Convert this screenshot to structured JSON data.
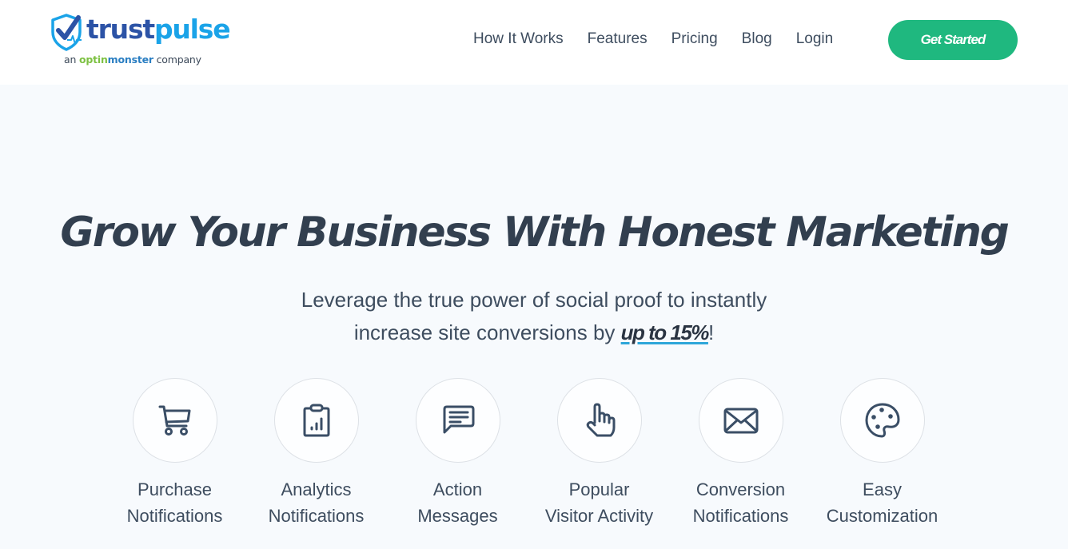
{
  "header": {
    "logo": {
      "word_part1": "trust",
      "word_part2": "pulse",
      "sub_prefix": "an ",
      "sub_brand_part1": "optin",
      "sub_brand_part2": "monster",
      "sub_suffix": " company",
      "colors": {
        "trust": "#2c53a6",
        "pulse": "#1aa3e8",
        "optin": "#7dc142",
        "monster": "#2a7ec2"
      }
    },
    "nav": [
      {
        "label": "How It Works"
      },
      {
        "label": "Features"
      },
      {
        "label": "Pricing"
      },
      {
        "label": "Blog"
      },
      {
        "label": "Login"
      }
    ],
    "cta_label": "Get Started",
    "cta_color": "#1fb87f"
  },
  "hero": {
    "title": "Grow Your Business With Honest Marketing",
    "subtitle_line1": "Leverage the true power of social proof to instantly",
    "subtitle_line2_prefix": "increase site conversions by ",
    "subtitle_highlight": "up to 15%",
    "subtitle_suffix": "!"
  },
  "features": [
    {
      "icon": "shopping-cart-icon",
      "line1": "Purchase",
      "line2": "Notifications"
    },
    {
      "icon": "analytics-clipboard-icon",
      "line1": "Analytics",
      "line2": "Notifications"
    },
    {
      "icon": "message-icon",
      "line1": "Action",
      "line2": "Messages"
    },
    {
      "icon": "pointer-hand-icon",
      "line1": "Popular",
      "line2": "Visitor Activity"
    },
    {
      "icon": "envelope-icon",
      "line1": "Conversion",
      "line2": "Notifications"
    },
    {
      "icon": "palette-icon",
      "line1": "Easy",
      "line2": "Customization"
    }
  ]
}
